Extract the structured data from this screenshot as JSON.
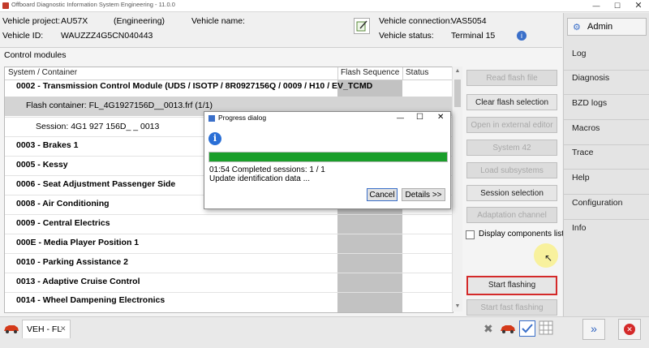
{
  "window": {
    "title": "Offboard Diagnostic Information System Engineering - 11.0.0"
  },
  "header": {
    "vehicle_project_label": "Vehicle project:",
    "vehicle_project_value": "AU57X",
    "mode": "(Engineering)",
    "vehicle_name_label": "Vehicle name:",
    "vehicle_id_label": "Vehicle ID:",
    "vehicle_id_value": "WAUZZZ4G5CN040443",
    "vehicle_connection_label": "Vehicle connection:",
    "vehicle_connection_value": "VAS5054",
    "vehicle_status_label": "Vehicle status:",
    "vehicle_status_value": "Terminal 15"
  },
  "main": {
    "section_title": "Control modules",
    "columns": [
      "System / Container",
      "Flash Sequence",
      "Status"
    ],
    "rows": [
      "0002 - Transmission Control Module  (UDS / ISOTP / 8R0927156Q / 0009 / H10 / EV_TCMD",
      "Flash container: FL_4G1927156D__0013.frf (1/1)",
      "Session: 4G1 927 156D_ _ 0013",
      "0003 - Brakes 1",
      "0005 - Kessy",
      "0006 - Seat Adjustment Passenger Side",
      "0008 - Air Conditioning",
      "0009 - Central Electrics",
      "000E - Media Player Position 1",
      "0010 - Parking Assistance 2",
      "0013 - Adaptive Cruise Control",
      "0014 - Wheel Dampening Electronics"
    ],
    "actions": {
      "read_flash_file": "Read flash file",
      "clear_flash_selection": "Clear flash selection",
      "open_external_editor": "Open in external editor",
      "system42": "System 42",
      "load_subsystems": "Load subsystems",
      "session_selection": "Session selection",
      "adaptation_channel": "Adaptation channel",
      "display_components_list": "Display components list",
      "start_flashing": "Start flashing",
      "start_fast_flashing": "Start fast flashing"
    }
  },
  "nav": {
    "admin": "Admin",
    "items": [
      "Log",
      "Diagnosis",
      "BZD logs",
      "Macros",
      "Trace",
      "Help",
      "Configuration",
      "Info"
    ]
  },
  "bottom": {
    "tab_label": "VEH - FL"
  },
  "dialog": {
    "title": "Progress dialog",
    "progress": 1.0,
    "status_line": "01:54  Completed sessions: 1 / 1",
    "detail_line": "Update identification data ...",
    "cancel": "Cancel",
    "details": "Details >>"
  },
  "colors": {
    "progress": "#1a9e2a",
    "highlight": "#d42a2a",
    "selected_row": "#d4d4d4"
  }
}
